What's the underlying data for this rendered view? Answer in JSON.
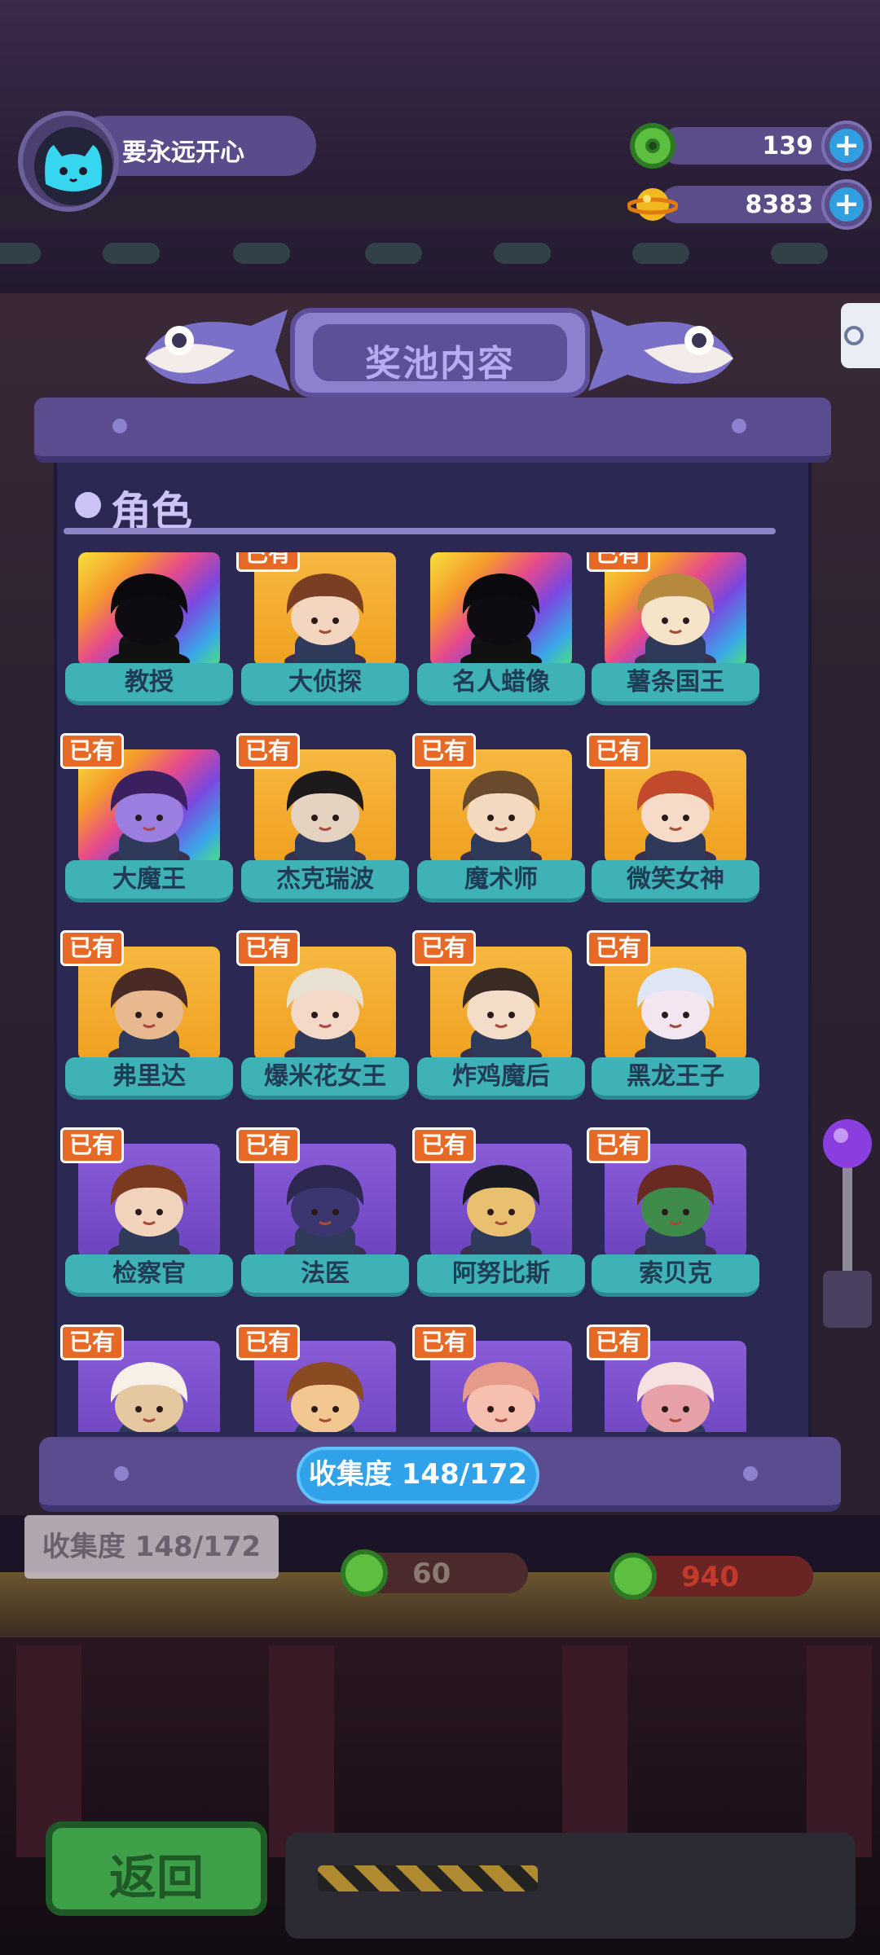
{
  "user": {
    "name": "要永远开心"
  },
  "currencies": [
    {
      "name": "donut-coin",
      "value": "139",
      "color": "#5cbf40"
    },
    {
      "name": "planet-coin",
      "value": "8383",
      "color": "#f2b820"
    }
  ],
  "panel": {
    "title": "奖池内容",
    "section_title": "角色",
    "progress_label": "收集度  148/172"
  },
  "owned_badge": "已有",
  "characters": [
    {
      "name": "教授",
      "owned": false,
      "bg": "rainbow"
    },
    {
      "name": "大侦探",
      "owned": true,
      "bg": "gold"
    },
    {
      "name": "名人蜡像",
      "owned": false,
      "bg": "rainbow"
    },
    {
      "name": "薯条国王",
      "owned": true,
      "bg": "rainbow"
    },
    {
      "name": "大魔王",
      "owned": true,
      "bg": "rainbow"
    },
    {
      "name": "杰克瑞波",
      "owned": true,
      "bg": "gold"
    },
    {
      "name": "魔术师",
      "owned": true,
      "bg": "gold"
    },
    {
      "name": "微笑女神",
      "owned": true,
      "bg": "gold"
    },
    {
      "name": "弗里达",
      "owned": true,
      "bg": "gold"
    },
    {
      "name": "爆米花女王",
      "owned": true,
      "bg": "gold"
    },
    {
      "name": "炸鸡魔后",
      "owned": true,
      "bg": "gold"
    },
    {
      "name": "黑龙王子",
      "owned": true,
      "bg": "gold"
    },
    {
      "name": "检察官",
      "owned": true,
      "bg": "purple"
    },
    {
      "name": "法医",
      "owned": true,
      "bg": "purple"
    },
    {
      "name": "阿努比斯",
      "owned": true,
      "bg": "purple"
    },
    {
      "name": "索贝克",
      "owned": true,
      "bg": "purple"
    },
    {
      "name": "",
      "owned": true,
      "bg": "purple"
    },
    {
      "name": "",
      "owned": true,
      "bg": "purple"
    },
    {
      "name": "",
      "owned": true,
      "bg": "purple"
    },
    {
      "name": "",
      "owned": true,
      "bg": "purple"
    }
  ],
  "background": {
    "collection_label": "收集度  148/172",
    "price_1": "60",
    "price_2": "940"
  },
  "back_button": "返回"
}
